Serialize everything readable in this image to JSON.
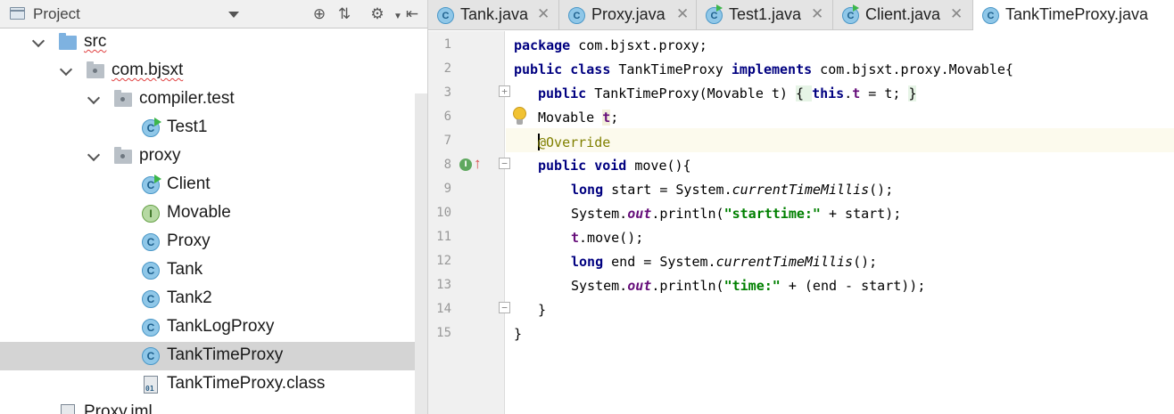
{
  "project": {
    "title": "Project",
    "tree": [
      {
        "label": "src",
        "type": "folder",
        "expanded": true,
        "squiggle": true
      },
      {
        "label": "com.bjsxt",
        "type": "package",
        "expanded": true,
        "squiggle": true
      },
      {
        "label": "compiler.test",
        "type": "package",
        "expanded": true
      },
      {
        "label": "Test1",
        "type": "class-run"
      },
      {
        "label": "proxy",
        "type": "package",
        "expanded": true
      },
      {
        "label": "Client",
        "type": "class-run"
      },
      {
        "label": "Movable",
        "type": "interface"
      },
      {
        "label": "Proxy",
        "type": "class"
      },
      {
        "label": "Tank",
        "type": "class"
      },
      {
        "label": "Tank2",
        "type": "class"
      },
      {
        "label": "TankLogProxy",
        "type": "class"
      },
      {
        "label": "TankTimeProxy",
        "type": "class",
        "selected": true
      },
      {
        "label": "TankTimeProxy.class",
        "type": "binary"
      },
      {
        "label": "Proxy.iml",
        "type": "iml"
      }
    ]
  },
  "tabs": [
    {
      "label": "Tank.java",
      "icon": "class",
      "active": false
    },
    {
      "label": "Proxy.java",
      "icon": "class",
      "active": false
    },
    {
      "label": "Test1.java",
      "icon": "class-run",
      "active": false
    },
    {
      "label": "Client.java",
      "icon": "class-run",
      "active": false
    },
    {
      "label": "TankTimeProxy.java",
      "icon": "class",
      "active": true
    }
  ],
  "editor": {
    "line_numbers": [
      "1",
      "2",
      "3",
      "6",
      "7",
      "8",
      "9",
      "10",
      "11",
      "12",
      "13",
      "14",
      "15"
    ],
    "code": {
      "l1_kw": "package",
      "l1_rest": " com.bjsxt.proxy;",
      "l2_kw1": "public class",
      "l2_name": " TankTimeProxy ",
      "l2_kw2": "implements",
      "l2_rest": " com.bjsxt.proxy.Movable{",
      "l3_kw": "public",
      "l3_sig": " TankTimeProxy(Movable t) ",
      "l3_open": "{ ",
      "l3_this": "this",
      "l3_dot": ".",
      "l3_fld": "t",
      "l3_assign": " = t; ",
      "l3_close": "}",
      "l6_type": "Movable ",
      "l6_fld": "t",
      "l6_semi": ";",
      "l7_ann": "@Override",
      "l8_kw": "public void",
      "l8_rest": " move(){",
      "l9_kw": "long",
      "l9_a": " start = System.",
      "l9_m": "currentTimeMillis",
      "l9_b": "();",
      "l10_a": "System.",
      "l10_out": "out",
      "l10_b": ".println(",
      "l10_str": "\"starttime:\"",
      "l10_c": " + start);",
      "l11_fld": "t",
      "l11_rest": ".move();",
      "l12_kw": "long",
      "l12_a": " end = System.",
      "l12_m": "currentTimeMillis",
      "l12_b": "();",
      "l13_a": "System.",
      "l13_out": "out",
      "l13_b": ".println(",
      "l13_str": "\"time:\"",
      "l13_c": " + (end - start));",
      "l14": "}",
      "l15": "}"
    }
  },
  "icons": {
    "project": "project-view-icon",
    "locate": "crosshair-icon",
    "collapse": "collapse-all-icon",
    "settings": "gear-icon",
    "hide": "hide-panel-icon",
    "bulb": "intention-bulb-icon",
    "implements": "implements-method-icon"
  },
  "colors": {
    "keyword": "#000080",
    "string": "#008000",
    "field": "#660e7a",
    "annotation": "#808000",
    "selection": "#d4d4d4",
    "current_line": "#fcfaed"
  }
}
